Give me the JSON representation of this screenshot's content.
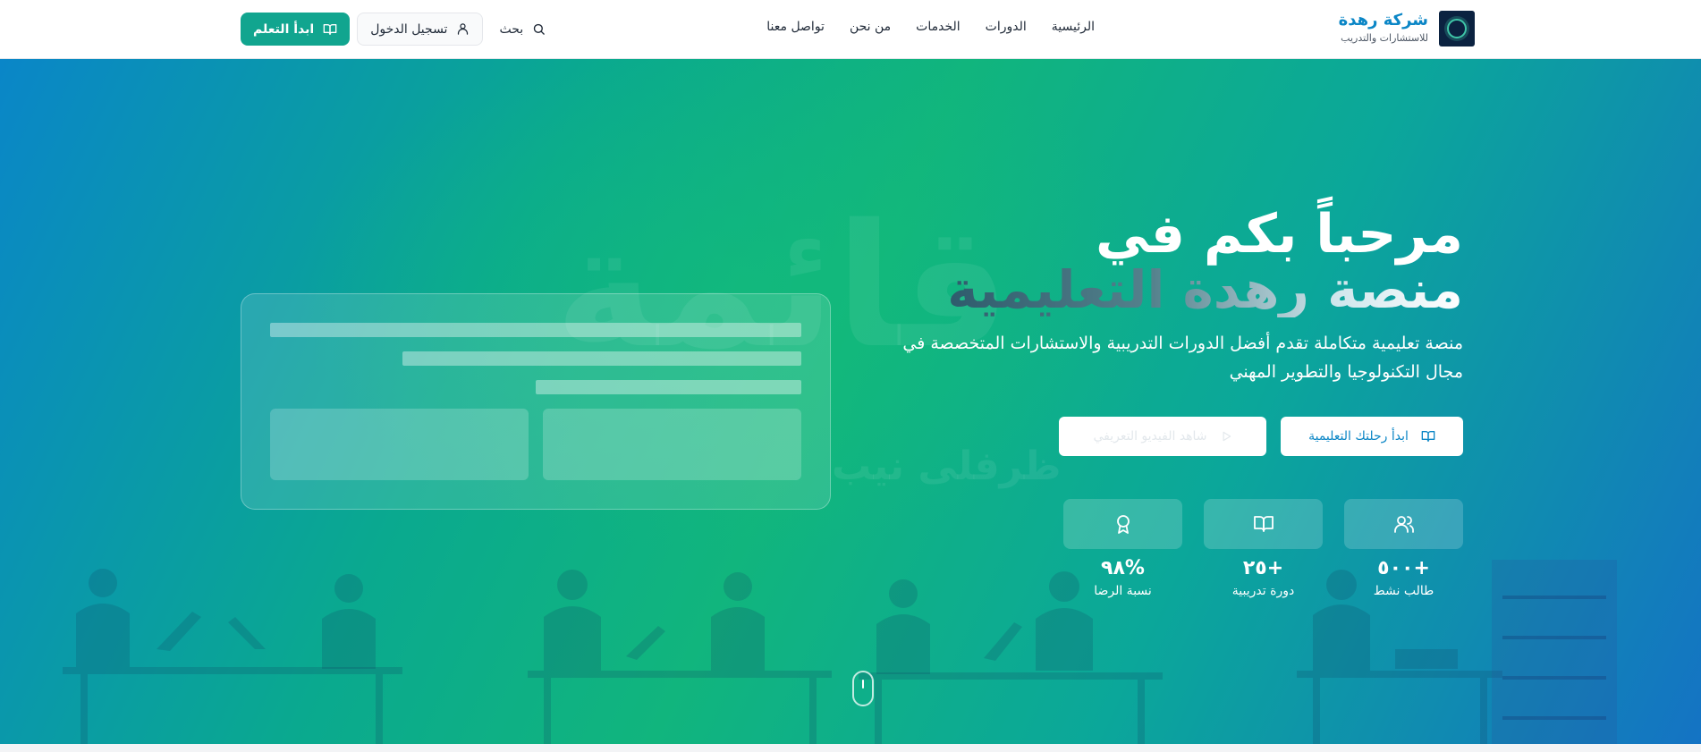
{
  "brand": {
    "name": "شركة رهدة",
    "tagline": "للاستشارات والتدريب"
  },
  "nav": {
    "links": [
      "الرئيسية",
      "الدورات",
      "الخدمات",
      "من نحن",
      "تواصل معنا"
    ]
  },
  "actions": {
    "search_label": "بحث",
    "login_label": "تسجيل الدخول",
    "start_label": "ابدأ التعلم"
  },
  "hero": {
    "title_line1": "مرحباً بكم في",
    "title_line2": "منصة رهدة التعليمية",
    "description": "منصة تعليمية متكاملة تقدم أفضل الدورات التدريبية والاستشارات المتخصصة في مجال التكنولوجيا والتطوير المهني",
    "primary_button": "ابدأ رحلتك التعليمية",
    "secondary_button": "شاهد الفيديو التعريفي",
    "watermark": "قائمة",
    "watermark_small": "ظرفلى نيب"
  },
  "stats": [
    {
      "value": "+٥٠٠",
      "label": "طالب نشط",
      "icon": "users-icon"
    },
    {
      "value": "+٢٥",
      "label": "دورة تدريبية",
      "icon": "book-icon"
    },
    {
      "value": "%٩٨",
      "label": "نسبة الرضا",
      "icon": "award-icon"
    }
  ],
  "colors": {
    "brand_blue": "#0b86c6",
    "brand_green": "#11a58f",
    "hero_start": "#0a86c8",
    "hero_mid": "#11b57d",
    "hero_end": "#1473c4"
  }
}
